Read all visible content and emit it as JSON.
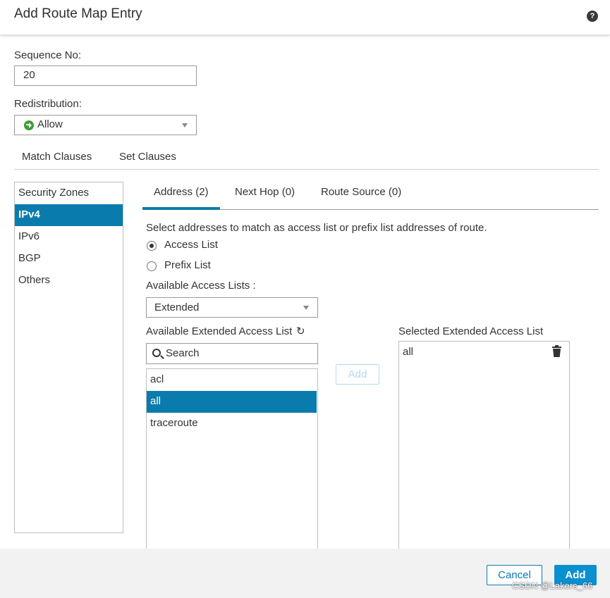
{
  "dialog": {
    "title": "Add Route Map Entry",
    "help_icon": "question-circle-icon"
  },
  "form": {
    "sequence_label": "Sequence No:",
    "sequence_value": "20",
    "redistribution_label": "Redistribution:",
    "redistribution_value": "Allow",
    "redistribution_icon": "arrow-circle-right-icon",
    "redistribution_icon_color": "#3f9c35"
  },
  "clause_tabs": [
    {
      "label": "Match Clauses"
    },
    {
      "label": "Set Clauses"
    }
  ],
  "sidebar": {
    "items": [
      {
        "label": "Security Zones"
      },
      {
        "label": "IPv4",
        "active": true
      },
      {
        "label": "IPv6"
      },
      {
        "label": "BGP"
      },
      {
        "label": "Others"
      }
    ]
  },
  "sub_tabs": [
    {
      "label": "Address (2)",
      "active": true
    },
    {
      "label": "Next Hop (0)"
    },
    {
      "label": "Route Source (0)"
    }
  ],
  "address": {
    "description": "Select addresses to match as access list or prefix list addresses of route.",
    "radio_access_list": "Access List",
    "radio_prefix_list": "Prefix List",
    "selected_radio": "Access List",
    "available_lists_label": "Available Access Lists :",
    "available_lists_value": "Extended",
    "available_extended_label": "Available Extended Access List",
    "selected_extended_label": "Selected Extended Access List",
    "search_placeholder": "Search",
    "available_items": [
      {
        "label": "acl"
      },
      {
        "label": "all",
        "selected": true
      },
      {
        "label": "traceroute"
      }
    ],
    "selected_items": [
      {
        "label": "all"
      }
    ],
    "add_button": "Add"
  },
  "footer": {
    "cancel_label": "Cancel",
    "add_label": "Add",
    "watermark": "CSDN @Lakers_66"
  },
  "colors": {
    "accent": "#0a7bad",
    "primary_button": "#0a8fd0",
    "footer_bg": "#f2f2f2"
  }
}
